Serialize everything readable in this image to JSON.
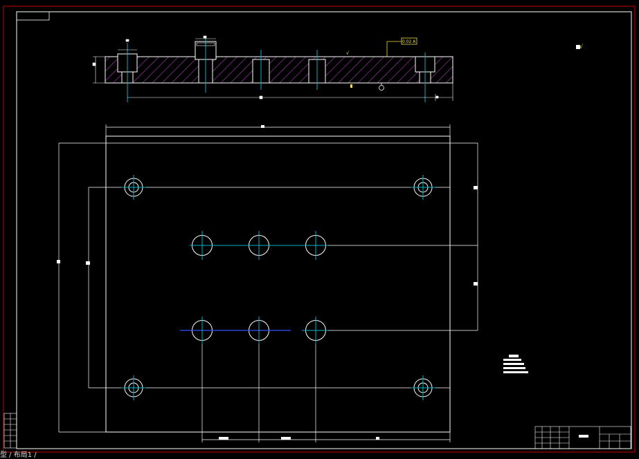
{
  "window": {
    "background": "#000000",
    "status_text": "型 / 布局1 /"
  },
  "drawing": {
    "colors": {
      "frame": "#c80000",
      "geometry": "#ffffff",
      "centerline": "#00b4c8",
      "hatch": "#b040c0",
      "dimension": "#ffffff",
      "annotation": "#f0e040",
      "blue_line": "#3050ff"
    },
    "tolerance_frame_text": "0.02 A",
    "surface_finish_symbol": "√",
    "datum_symbol": "A"
  }
}
